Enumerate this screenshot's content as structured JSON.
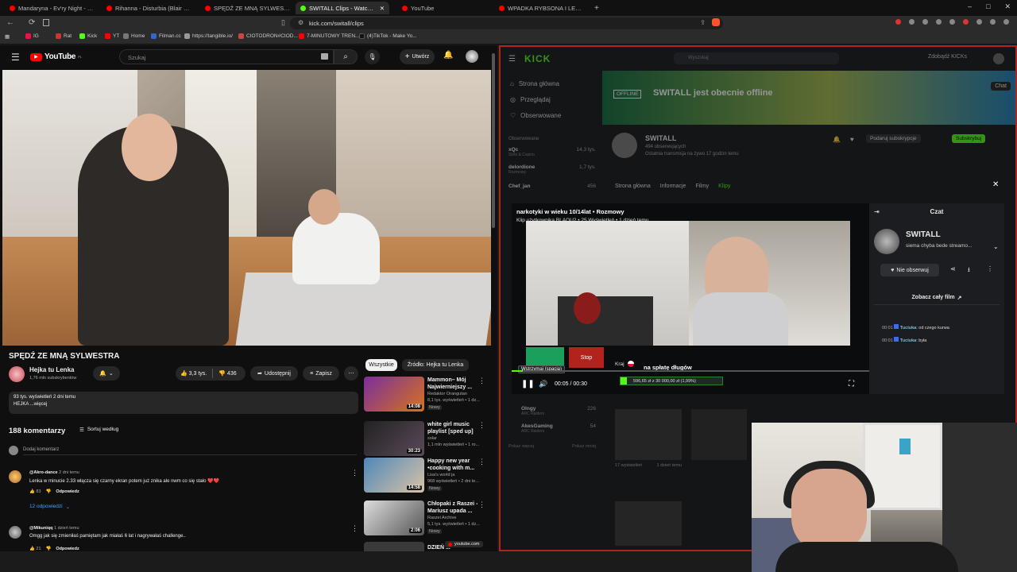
{
  "browser": {
    "tabs": [
      {
        "label": "Mandaryna - Ev'ry Night - YouTube",
        "color": "#ff0000"
      },
      {
        "label": "Rihanna - Disturbia (Blair Muir Remix)",
        "color": "#ff0000"
      },
      {
        "label": "SPĘDŹ ZE MNĄ SYLWESTRA - YouTube",
        "color": "#ff0000"
      },
      {
        "label": "SWITALL Clips - Watch Live o...",
        "color": "#53fc18"
      },
      {
        "label": "YouTube",
        "color": "#ff0000"
      },
      {
        "label": "WPADKA RYBSONA I LEQUIT MAMM...",
        "color": "#ff0000"
      }
    ],
    "url": "kick.com/switall/clips",
    "bookmarks": [
      "IG",
      "Rat",
      "Kick",
      "YT",
      "Home",
      "Filman.cc",
      "https://tangible.io/",
      "CIOTODRON#CIOD...",
      "7-MINUTOWY TREN...",
      "(4)TikTok - Make Yo..."
    ]
  },
  "youtube": {
    "logo_text": "YouTube",
    "logo_region": "PL",
    "search_placeholder": "Szukaj",
    "create_label": "Utwórz",
    "video_title": "SPĘDŹ ZE MNĄ SYLWESTRA",
    "channel_name": "Hejka tu Lenka",
    "channel_subs": "1,76 mln subskrybentów",
    "likes": "3,3 tys.",
    "dislikes": "436",
    "share_label": "Udostępnij",
    "save_label": "Zapisz",
    "views_line": "93 tys. wyświetleń  2 dni temu",
    "desc_line": "HEJKA ...więcej",
    "filter_all": "Wszystkie",
    "filter_source": "Źródło: Hejka tu Lenka",
    "comments_count": "188 komentarzy",
    "sort_label": "Sortuj według",
    "add_comment": "Dodaj komentarz",
    "comments": [
      {
        "author": "@Akro-dance",
        "time": "2 dni temu",
        "text": "Lenka w minucie 2.33 włącza się czarny ekran potem już znika ale nwm co się stało ❤️❤️",
        "likes": "83",
        "reply": "Odpowiedz",
        "replies": "12 odpowiedzi"
      },
      {
        "author": "@Mikuniqq",
        "time": "1 dzień temu",
        "text": "Omgg jak się zmieniłaś pamiętam jak miałaś 6 lat i nagrywałaś challenge..",
        "likes": "21",
        "reply": "Odpowiedz"
      }
    ],
    "recommendations": [
      {
        "title": "Mammon– Mój Najwierniejszy ...",
        "channel": "Redaktor Orangutan",
        "meta": "8,1 tys. wyświetleń • 1 dz...",
        "badge": "Nowy",
        "duration": "14:08",
        "thumb": "#6b2f8f"
      },
      {
        "title": "white girl music playlist [sped up]",
        "channel": "solar",
        "meta": "1,1 mln wyświetleń • 1 ro...",
        "badge": "",
        "duration": "30:23",
        "thumb": "#2a2a2a"
      },
      {
        "title": "Happy new year •cooking with m...",
        "channel": "Lisa's world ja",
        "meta": "968 wyświetleń • 2 dni te...",
        "badge": "Nowy",
        "duration": "14:58",
        "thumb": "#3a6e9c"
      },
      {
        "title": "Chłopaki z Raszei - Mariusz upada ...",
        "channel": "Raszei Archive",
        "meta": "5,1 tys. wyświetleń • 1 dz...",
        "badge": "Nowy",
        "duration": "2:06",
        "thumb": "#444"
      },
      {
        "title": "DZIEŃ ...",
        "channel": "",
        "meta": "",
        "badge": "",
        "duration": "",
        "thumb": "#555"
      }
    ],
    "toast": "youtube.com"
  },
  "kick": {
    "logo": "KICK",
    "search_placeholder": "Wyszukaj",
    "earn_label": "Zdobądź KICKs",
    "nav": [
      "Strona główna",
      "Przeglądaj",
      "Obserwowane"
    ],
    "following_header": "Obserwowane",
    "following": [
      {
        "name": "xQc",
        "sub": "Slots & Casino",
        "count": "14,3 tys."
      },
      {
        "name": "delordione",
        "sub": "Rozmowy",
        "count": "1,7 tys."
      },
      {
        "name": "Chef_jan",
        "sub": "",
        "count": "456"
      },
      {
        "name": "Olngy",
        "sub": "ARC Raiders",
        "count": "226"
      },
      {
        "name": "AkesGaming",
        "sub": "ARC Raiders",
        "count": "54"
      }
    ],
    "show_more": "Pokaż więcej",
    "show_less": "Pokaż mniej",
    "offline_badge": "OFFLINE",
    "offline_text": "SWITALL jest obecnie offline",
    "chat_btn": "Chat",
    "channel_name": "SWITALL",
    "channel_followers": "494 obserwujących",
    "last_stream": "Ostatnia transmisja na żywo 17 godzin temu",
    "gift_btn": "Podaruj subskrypcje",
    "sub_btn": "Subskrybuj",
    "channel_tabs": [
      "Strona główna",
      "Informacje",
      "Filmy",
      "Klipy"
    ],
    "clip_views": "17 wyświetleń",
    "clip_time": "1 dzień temu"
  },
  "clip_modal": {
    "title": "narkotyki w wieku 10/14lat • Rozmowy",
    "meta": "Klip użytkownika BLAQU2 • 25 Wyświetleń • 1 dzień temu",
    "tooltip": "Wstrzymaj (spacja)",
    "time": "00:05 / 00:30",
    "stop_label": "Stop",
    "country_label": "Kraj",
    "subtitle": "na spłatę długów",
    "progress_text": "596,65 zł z 30 000,00 zł (1,99%)",
    "progress_fraction": 0.0199,
    "close_icon": "close-icon"
  },
  "clip_chat": {
    "header": "Czat",
    "streamer": "SWITALL",
    "status": "siema chyba bede streamo...",
    "unfollow": "Nie obserwuj",
    "watch_full": "Zobacz cały film",
    "messages": [
      {
        "time": "00:01",
        "user": "Tuciuka",
        "text": "od czego kurwa"
      },
      {
        "time": "00:01",
        "user": "Tuciuka",
        "text": "była"
      }
    ]
  },
  "colors": {
    "kick_green": "#53fc18",
    "yt_red": "#ff0000",
    "kick_border": "#b3231d"
  }
}
